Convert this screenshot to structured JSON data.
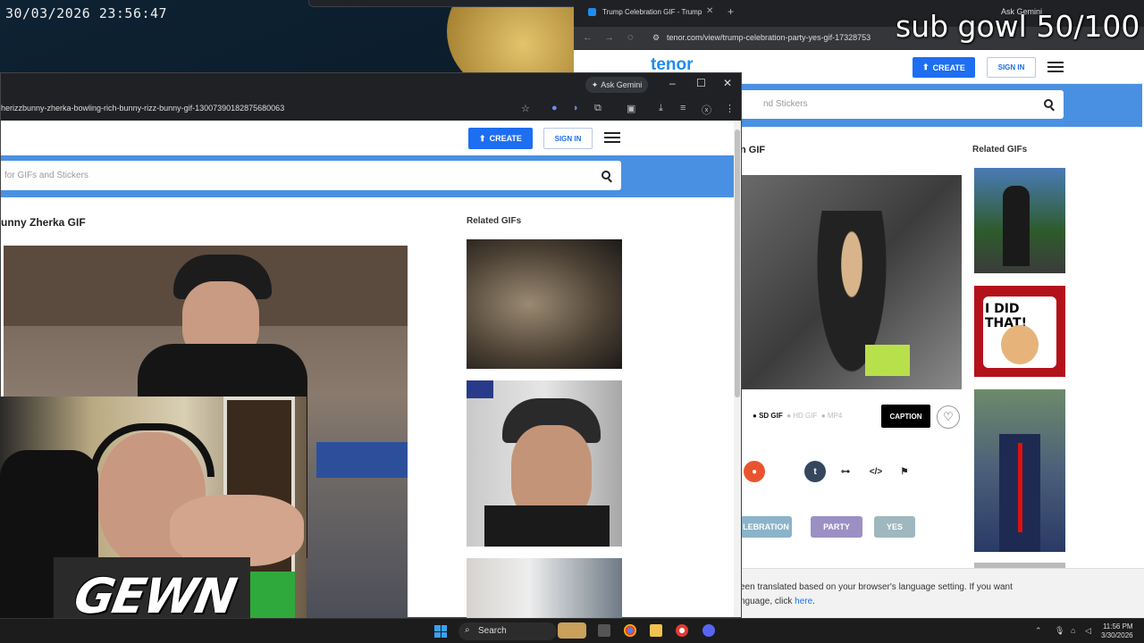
{
  "stream": {
    "datetime": "30/03/2026 23:56:47",
    "goal_text": "sub gowl 50/100",
    "webcam_logo": "GEWN"
  },
  "back_browser": {
    "tab_title": "Trump Celebration GIF - Trump",
    "ask_gemini": "Ask Gemini",
    "url": "tenor.com/view/trump-celebration-party-yes-gif-17328753",
    "logo": "tenor",
    "create_label": "CREATE",
    "sign_in_label": "SIGN IN",
    "search_placeholder": "nd Stickers",
    "page_title": "n GIF",
    "related_heading": "Related GIFs",
    "formats": [
      "SD GIF",
      "HD GIF",
      "MP4"
    ],
    "caption_label": "CAPTION",
    "tags": [
      "LEBRATION",
      "PARTY",
      "YES"
    ],
    "related_sticker_text": "I DID THAT!",
    "notice_text": "een translated based on your browser's language setting. If you want",
    "notice_text2": "nguage, click ",
    "notice_link": "here",
    "notice_end": "."
  },
  "front_browser": {
    "ask_gemini": "Ask Gemini",
    "url": "herizzbunny-zherka-bowling-rich-bunny-rizz-bunny-gif-13007390182875680063",
    "create_label": "CREATE",
    "sign_in_label": "SIGN IN",
    "search_placeholder": "for GIFs and Stickers",
    "page_title": "unny Zherka GIF",
    "related_heading": "Related GIFs"
  },
  "taskbar": {
    "search_label": "Search",
    "time": "11:56 PM",
    "date": "3/30/2026"
  },
  "colors": {
    "tenor_blue": "#4a90e2",
    "button_blue": "#1d6ef1",
    "tag_celebration": "#8bb3c9",
    "tag_party": "#9b8fc4",
    "tag_yes": "#9fb7bf"
  }
}
